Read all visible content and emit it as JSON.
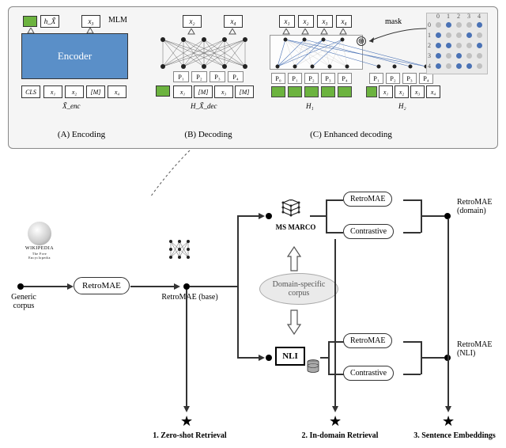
{
  "top_panel": {
    "section_a": {
      "caption": "(A) Encoding",
      "encoder_label": "Encoder",
      "mlm_label": "MLM",
      "out_h": "h_X̃",
      "out_x3": "x₃",
      "tokens": [
        "CLS",
        "x₁",
        "x₂",
        "[M]",
        "x₄"
      ],
      "sub": "X̃_enc"
    },
    "section_b": {
      "caption": "(B) Decoding",
      "out_x2": "x₂",
      "out_x4": "x₄",
      "p_boxes": [
        "P₁",
        "P₂",
        "P₃",
        "P₄"
      ],
      "tokens": [
        "x₁",
        "[M]",
        "x₃",
        "[M]"
      ],
      "sub": "H_X̃_dec"
    },
    "section_c": {
      "caption": "(C) Enhanced decoding",
      "out": [
        "x₁",
        "x₂",
        "x₃",
        "x₄"
      ],
      "mask_label": "mask",
      "p_boxes_h1": [
        "P₀",
        "P₁",
        "P₂",
        "P₃",
        "P₄"
      ],
      "p_boxes_h2": [
        "P₁",
        "P₂",
        "P₃",
        "P₄"
      ],
      "tokens_h2": [
        "x₁",
        "x₂",
        "x₃",
        "x₄"
      ],
      "h1_label": "H₁",
      "h2_label": "H₂",
      "oplus": "⊕",
      "mask_axis": [
        "0",
        "1",
        "2",
        "3",
        "4"
      ]
    }
  },
  "flow": {
    "generic_corpus": "Generic\ncorpus",
    "wikipedia": "WIKIPEDIA",
    "wiki_sub": "The Free Encyclopedia",
    "retromae": "RetroMAE",
    "retromae_base": "RetroMAE (base)",
    "domain_corpus": "Domain-specific\ncorpus",
    "msmarco": "MS MARCO",
    "nli": "NLI",
    "retromae_top": "RetroMAE",
    "contrastive_top": "Contrastive",
    "retromae_bot": "RetroMAE",
    "contrastive_bot": "Contrastive",
    "retromae_domain": "RetroMAE\n(domain)",
    "retromae_nli": "RetroMAE\n(NLI)",
    "task1": "1. Zero-shot Retrieval",
    "task2": "2. In-domain Retrieval",
    "task3": "3. Sentence Embeddings"
  },
  "mask_matrix": {
    "size": 5,
    "blue_cells": [
      [
        0,
        1
      ],
      [
        0,
        4
      ],
      [
        1,
        0
      ],
      [
        1,
        3
      ],
      [
        2,
        0
      ],
      [
        2,
        1
      ],
      [
        2,
        4
      ],
      [
        3,
        0
      ],
      [
        3,
        2
      ],
      [
        4,
        0
      ],
      [
        4,
        2
      ],
      [
        4,
        3
      ]
    ]
  }
}
